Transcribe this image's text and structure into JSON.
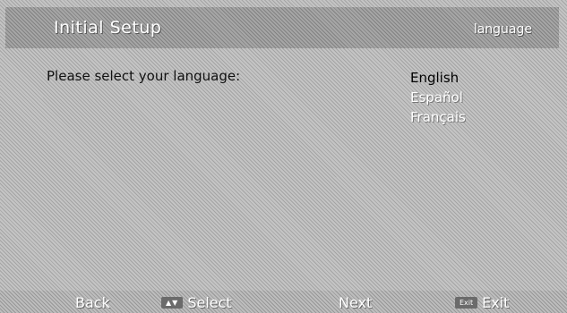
{
  "header": {
    "title": "Initial Setup",
    "section": "language"
  },
  "main": {
    "prompt": "Please select your language:",
    "languages": [
      {
        "label": "English",
        "selected": true
      },
      {
        "label": "Español",
        "selected": false
      },
      {
        "label": "Français",
        "selected": false
      }
    ]
  },
  "footer": {
    "back_label": "Back",
    "select_key": "▲▼",
    "select_label": "Select",
    "next_label": "Next",
    "exit_key": "Exit",
    "exit_label": "Exit"
  },
  "colors": {
    "background": "#c4c4c4",
    "header": "#a6a6a6",
    "selected_text": "#000000",
    "unselected_text": "#ffffff"
  }
}
